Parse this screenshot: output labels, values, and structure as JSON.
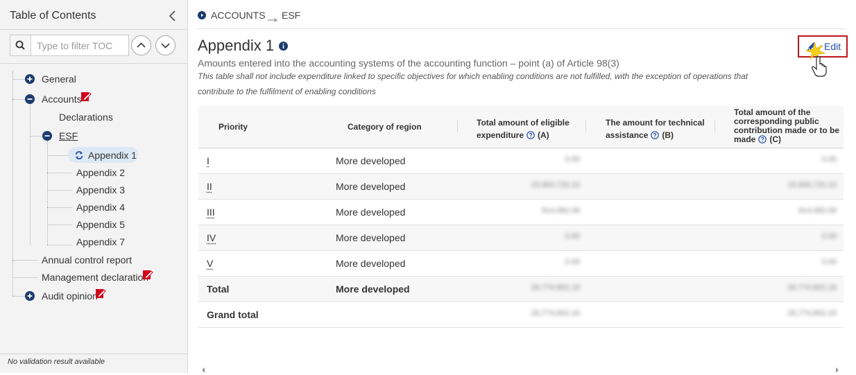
{
  "sidebar": {
    "title": "Table of Contents",
    "filter_placeholder": "Type to filter TOC",
    "status_text": "No validation result available",
    "tree": {
      "general": "General",
      "accounts": "Accounts",
      "declarations": "Declarations",
      "esf": "ESF",
      "appendices": [
        "Appendix 1",
        "Appendix 2",
        "Appendix 3",
        "Appendix 4",
        "Appendix 5",
        "Appendix 7"
      ],
      "annual_control_report": "Annual control report",
      "management_declaration": "Management declaration",
      "audit_opinion": "Audit opinion"
    }
  },
  "breadcrumb": {
    "first": "ACCOUNTS",
    "second": "ESF"
  },
  "main": {
    "title": "Appendix 1",
    "subtitle": "Amounts entered into the accounting systems of the accounting function – point (a) of Article 98(3)",
    "note": "This table shall not include expenditure linked to specific objectives for which enabling conditions are not fulfilled, with the exception of operations that contribute to the fulfilment of enabling conditions",
    "edit_label": "Edit"
  },
  "table": {
    "headers": {
      "priority": "Priority",
      "category": "Category of region",
      "total_eligible": "Total amount of eligible expenditure",
      "total_eligible_suffix": "(A)",
      "technical": "The amount for technical assistance",
      "technical_suffix": "(B)",
      "public": "Total amount of the corresponding public contribution made or to be made",
      "public_suffix": "(C)"
    },
    "rows": [
      {
        "priority": "I",
        "region": "More developed",
        "a": "0.00",
        "c": "0.00"
      },
      {
        "priority": "II",
        "region": "More developed",
        "a": "15,900,720.10",
        "c": "15,900,720.10"
      },
      {
        "priority": "III",
        "region": "More developed",
        "a": "914,082.06",
        "c": "914,082.06"
      },
      {
        "priority": "IV",
        "region": "More developed",
        "a": "0.00",
        "c": "0.00"
      },
      {
        "priority": "V",
        "region": "More developed",
        "a": "0.00",
        "c": "0.00"
      }
    ],
    "total": {
      "label": "Total",
      "region": "More developed",
      "a": "26,774,802.16",
      "c": "26,774,802.16"
    },
    "grand_total": {
      "label": "Grand total",
      "a": "26,774,802.16",
      "c": "26,774,802.16"
    }
  },
  "colors": {
    "navy": "#1c3b6e",
    "accent_blue": "#1f4fa3",
    "edit_border": "#c0141e",
    "flag_red": "#d0021b"
  }
}
